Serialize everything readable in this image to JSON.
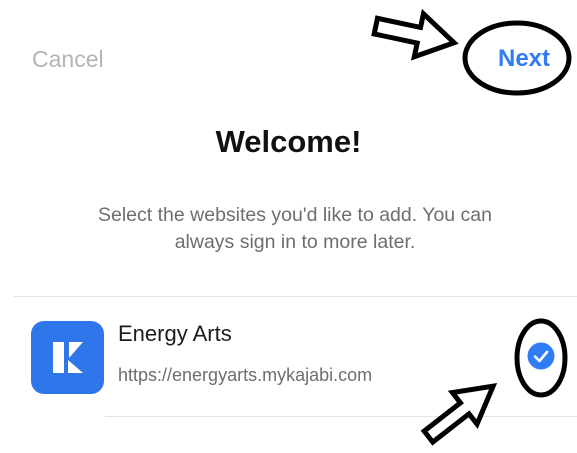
{
  "header": {
    "cancel_label": "Cancel",
    "next_label": "Next"
  },
  "main": {
    "title": "Welcome!",
    "subtitle_line1": "Select the websites you'd like to add. You can",
    "subtitle_line2": "always sign in to more later."
  },
  "sites": [
    {
      "name": "Energy Arts",
      "url": "https://energyarts.mykajabi.com",
      "selected": true,
      "icon": "kajabi-k-logo-icon"
    }
  ],
  "annotations": {
    "arrow_icon": "hollow-arrow-icon",
    "highlight": "hand-drawn-ellipse"
  },
  "colors": {
    "accent": "#2f7cf6",
    "app_icon_bg": "#2f76eb",
    "cancel_text": "#b3b3b8",
    "secondary_text": "#6d6d72",
    "annotation": "#000000"
  }
}
